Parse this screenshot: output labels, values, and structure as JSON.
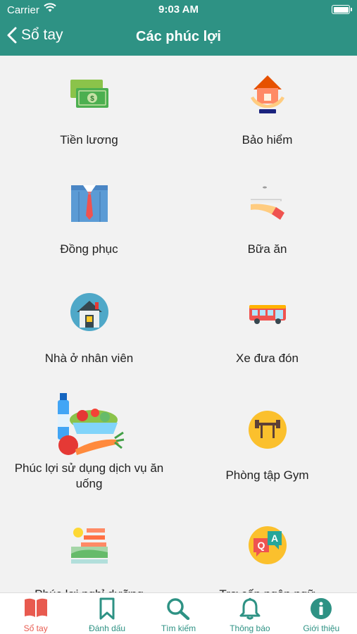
{
  "status_bar": {
    "carrier": "Carrier",
    "time": "9:03 AM"
  },
  "nav": {
    "back_label": "Sổ tay",
    "title": "Các phúc lợi"
  },
  "benefits": [
    {
      "label": "Tiền lương",
      "icon": "money-icon"
    },
    {
      "label": "Bảo hiểm",
      "icon": "insurance-house-icon"
    },
    {
      "label": "Đồng phục",
      "icon": "uniform-shirt-icon"
    },
    {
      "label": "Bữa ăn",
      "icon": "meal-tray-icon"
    },
    {
      "label": "Nhà ở nhân viên",
      "icon": "staff-house-icon"
    },
    {
      "label": "Xe đưa đón",
      "icon": "shuttle-bus-icon"
    },
    {
      "label": "Phúc lợi sử dụng dịch vụ ăn uống",
      "icon": "food-drink-icon"
    },
    {
      "label": "Phòng tập Gym",
      "icon": "gym-barbell-icon"
    },
    {
      "label": "Phúc lợi nghỉ dưỡng",
      "icon": "vacation-icon"
    },
    {
      "label": "Trợ cấp ngôn ngữ",
      "icon": "language-qa-icon"
    }
  ],
  "tabs": [
    {
      "label": "Sổ tay",
      "icon": "book-icon",
      "active": true
    },
    {
      "label": "Đánh dấu",
      "icon": "bookmark-icon",
      "active": false
    },
    {
      "label": "Tìm kiếm",
      "icon": "search-icon",
      "active": false
    },
    {
      "label": "Thông báo",
      "icon": "bell-icon",
      "active": false
    },
    {
      "label": "Giới thiệu",
      "icon": "info-icon",
      "active": false
    }
  ],
  "colors": {
    "header": "#2e9284",
    "accent": "#2e9284",
    "active_tab": "#e85a4f"
  }
}
